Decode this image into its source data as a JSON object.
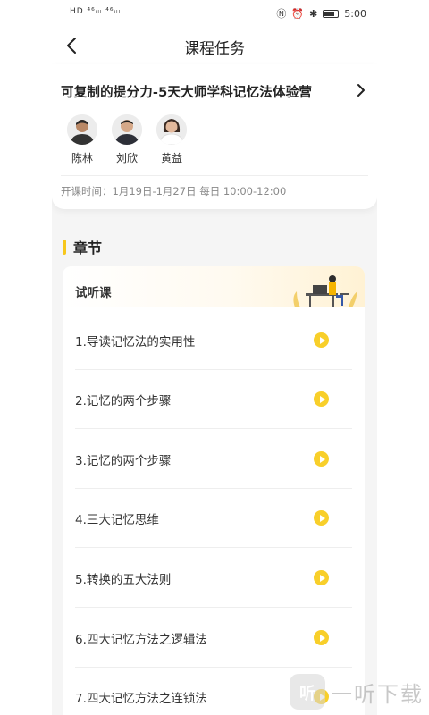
{
  "status_bar": {
    "signal_text": "HD ⁴⁶ᵢₗₗ ⁴⁶ᵢₗₗ",
    "time": "5:00"
  },
  "header": {
    "title": "课程任务",
    "back_icon": "chevron-left-icon"
  },
  "course": {
    "title": "可复制的提分力-5天大师学科记忆法体验营",
    "teachers": [
      {
        "name": "陈林"
      },
      {
        "name": "刘欣"
      },
      {
        "name": "黄益"
      }
    ],
    "schedule": "开课时间：1月19日-1月27日 每日 10:00-12:00"
  },
  "chapter": {
    "heading": "章节",
    "trial_label": "试听课",
    "lessons": [
      {
        "title": "1.导读记忆法的实用性"
      },
      {
        "title": "2.记忆的两个步骤"
      },
      {
        "title": "3.记忆的两个步骤"
      },
      {
        "title": "4.三大记忆思维"
      },
      {
        "title": "5.转换的五大法则"
      },
      {
        "title": "6.四大记忆方法之逻辑法"
      },
      {
        "title": "7.四大记忆方法之连锁法"
      }
    ]
  },
  "watermark": {
    "logo_text": "听",
    "text": "一听下载"
  },
  "colors": {
    "accent": "#f7c71c",
    "play": "#f8cf2a"
  }
}
